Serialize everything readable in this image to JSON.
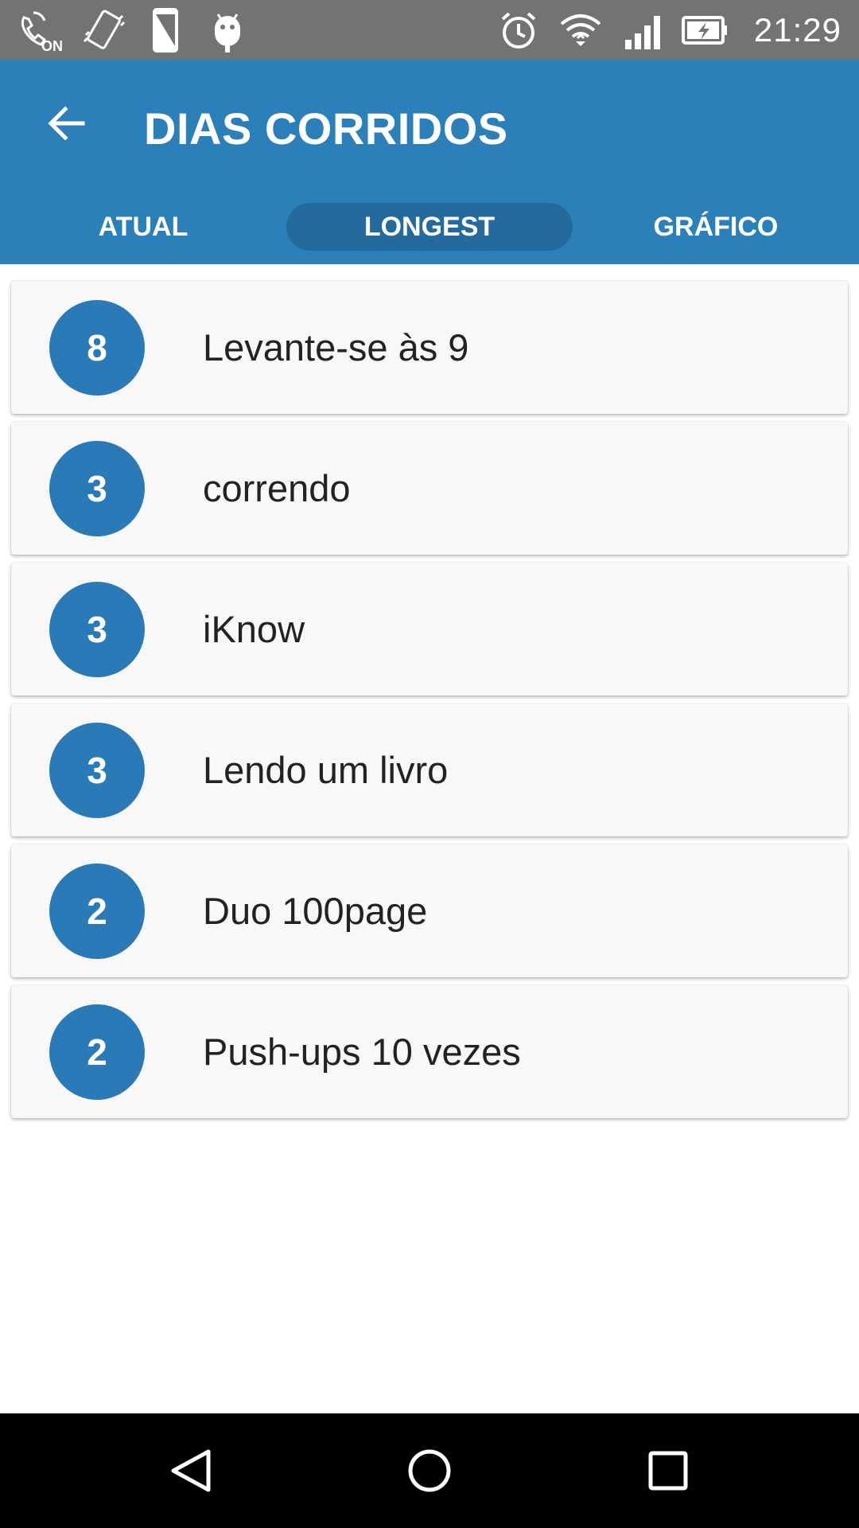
{
  "status_bar": {
    "time": "21:29",
    "left_icons": [
      "volte-on-icon",
      "vibrate-icon",
      "screenshot-icon",
      "android-debug-icon"
    ],
    "right_icons": [
      "alarm-icon",
      "wifi-icon",
      "signal-icon",
      "battery-charging-icon"
    ]
  },
  "appbar": {
    "title": "DIAS CORRIDOS",
    "back_icon": "arrow-back-icon"
  },
  "tabs": [
    {
      "label": "ATUAL",
      "selected": false
    },
    {
      "label": "LONGEST",
      "selected": true
    },
    {
      "label": "GRÁFICO",
      "selected": false
    }
  ],
  "streaks": [
    {
      "count": "8",
      "name": "Levante-se às 9"
    },
    {
      "count": "3",
      "name": "correndo"
    },
    {
      "count": "3",
      "name": "iKnow"
    },
    {
      "count": "3",
      "name": "Lendo um livro"
    },
    {
      "count": "2",
      "name": "Duo 100page"
    },
    {
      "count": "2",
      "name": "Push-ups 10 vezes"
    }
  ],
  "colors": {
    "primary": "#2b80ba",
    "tab_selected": "#246a9c",
    "badge": "#2b7ab8",
    "status_bar": "#737373"
  },
  "nav_bar": [
    "nav-back-icon",
    "nav-home-icon",
    "nav-recents-icon"
  ]
}
